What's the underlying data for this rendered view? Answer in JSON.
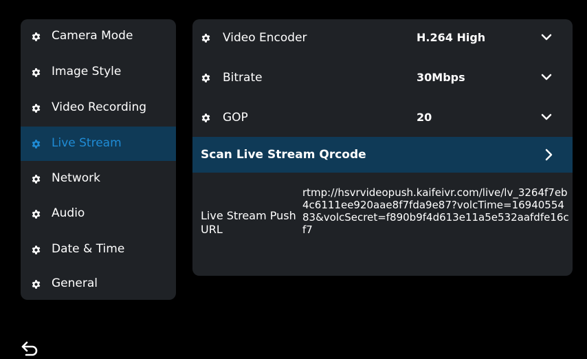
{
  "sidebar": {
    "items": [
      {
        "label": "Camera Mode",
        "icon": "gear-icon",
        "active": false
      },
      {
        "label": "Image Style",
        "icon": "gear-icon",
        "active": false
      },
      {
        "label": "Video Recording",
        "icon": "gear-icon",
        "active": false
      },
      {
        "label": "Live Stream",
        "icon": "gear-icon",
        "active": true
      },
      {
        "label": "Network",
        "icon": "gear-icon",
        "active": false
      },
      {
        "label": "Audio",
        "icon": "gear-icon",
        "active": false
      },
      {
        "label": "Date & Time",
        "icon": "gear-icon",
        "active": false
      },
      {
        "label": "General",
        "icon": "gear-icon",
        "active": false
      }
    ]
  },
  "main": {
    "settings": [
      {
        "label": "Video Encoder",
        "value": "H.264 High",
        "icon": "chevron-down-icon"
      },
      {
        "label": "Bitrate",
        "value": "30Mbps",
        "icon": "chevron-down-icon"
      },
      {
        "label": "GOP",
        "value": "20",
        "icon": "chevron-down-icon"
      }
    ],
    "scan": {
      "label": "Scan Live Stream Qrcode",
      "icon": "chevron-right-icon"
    },
    "push_url": {
      "label": "Live Stream Push URL",
      "value": "rtmp://hsvrvideopush.kaifeivr.com/live/lv_3264f7eb4c6111ee920aae8f7fda9e87?volcTime=1694055483&volcSecret=f890b9f4d613e11a5e532aafdfe16cf7"
    }
  },
  "footer": {
    "back_icon": "back-arrow-icon"
  },
  "colors": {
    "background": "#000000",
    "panel": "#1f2226",
    "highlight": "#0f3a57",
    "accent": "#1f8cd6",
    "text": "#ffffff"
  }
}
